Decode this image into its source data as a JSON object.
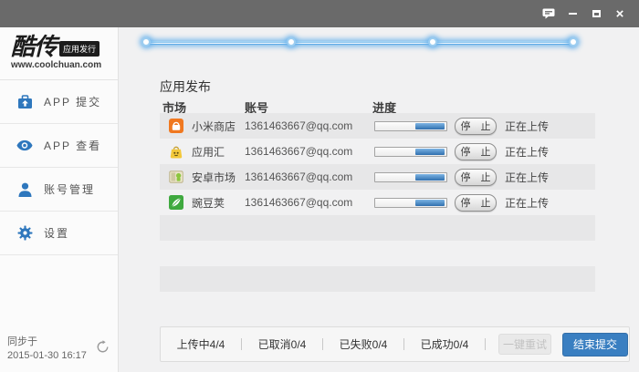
{
  "titlebar": {
    "icons": [
      {
        "name": "feedback-icon"
      },
      {
        "name": "minimize-icon"
      },
      {
        "name": "maximize-icon"
      },
      {
        "name": "close-icon",
        "glyph": "×"
      }
    ]
  },
  "sidebar": {
    "logo": {
      "brand": "酷传",
      "badge": "应用发行",
      "website": "www.coolchuan.com"
    },
    "menu": [
      {
        "label": "APP 提交",
        "icon": "briefcase-upload-icon"
      },
      {
        "label": "APP 查看",
        "icon": "eye-icon"
      },
      {
        "label": "账号管理",
        "icon": "user-icon"
      },
      {
        "label": "设置",
        "icon": "gear-icon"
      }
    ],
    "sync": {
      "label": "同步于",
      "time": "2015-01-30 16:17",
      "icon": "refresh-icon"
    }
  },
  "main": {
    "stepper": {
      "steps": 4,
      "positions_percent": [
        0,
        34,
        67,
        100
      ]
    },
    "section_title": "应用发布",
    "table": {
      "headers": [
        "市场",
        "账号",
        "进度"
      ],
      "rows": [
        {
          "market": "小米商店",
          "icon": "xiaomi",
          "account": "1361463667@qq.com",
          "progress_from": 57,
          "progress_to": 98,
          "action": "停 止",
          "status": "正在上传"
        },
        {
          "market": "应用汇",
          "icon": "yingyonghui",
          "account": "1361463667@qq.com",
          "progress_from": 57,
          "progress_to": 98,
          "action": "停 止",
          "status": "正在上传"
        },
        {
          "market": "安卓市场",
          "icon": "anzhuo",
          "account": "1361463667@qq.com",
          "progress_from": 57,
          "progress_to": 98,
          "action": "停 止",
          "status": "正在上传"
        },
        {
          "market": "豌豆荚",
          "icon": "wandoujia",
          "account": "1361463667@qq.com",
          "progress_from": 57,
          "progress_to": 98,
          "action": "停 止",
          "status": "正在上传"
        }
      ],
      "empty_rows": 3
    },
    "footer": {
      "stats": [
        "上传中4/4",
        "已取消0/4",
        "已失败0/4",
        "已成功0/4"
      ],
      "retry_button": "一键重试",
      "submit_button": "结束提交"
    }
  },
  "colors": {
    "titlebar": "#6a6a6a",
    "accent_blue": "#3a7fc1",
    "progress_blue": "#2f6fae",
    "stepper_glow": "#6eb4ec",
    "sidebar_icon_blue": "#2e77bd",
    "row_stripe": "#e7e7e8"
  }
}
